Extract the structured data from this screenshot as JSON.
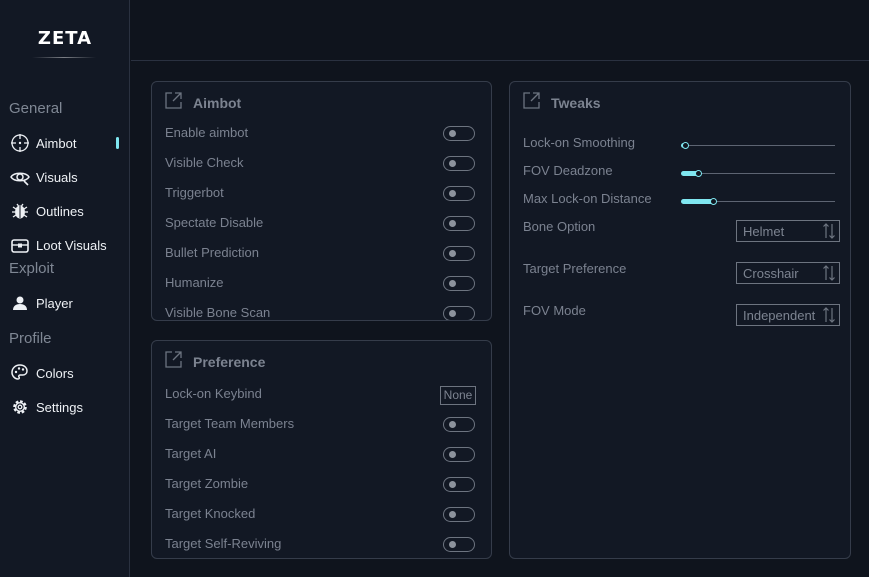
{
  "app": {
    "logo": "ZETA"
  },
  "sidebar": {
    "sections": [
      {
        "label": "General"
      },
      {
        "label": "Exploit"
      },
      {
        "label": "Profile"
      }
    ],
    "items": [
      {
        "label": "Aimbot",
        "icon": "crosshair-icon",
        "active": true
      },
      {
        "label": "Visuals",
        "icon": "eye-icon"
      },
      {
        "label": "Outlines",
        "icon": "bug-icon"
      },
      {
        "label": "Loot Visuals",
        "icon": "chest-icon"
      },
      {
        "label": "Player",
        "icon": "user-icon"
      },
      {
        "label": "Colors",
        "icon": "palette-icon"
      },
      {
        "label": "Settings",
        "icon": "gear-icon"
      }
    ],
    "accent_color": "#7fe6f0"
  },
  "panels": {
    "aimbot": {
      "title": "Aimbot",
      "rows": [
        {
          "label": "Enable aimbot",
          "on": false
        },
        {
          "label": "Visible Check",
          "on": false
        },
        {
          "label": "Triggerbot",
          "on": false
        },
        {
          "label": "Spectate Disable",
          "on": false
        },
        {
          "label": "Bullet Prediction",
          "on": false
        },
        {
          "label": "Humanize",
          "on": false
        },
        {
          "label": "Visible Bone Scan",
          "on": false
        }
      ]
    },
    "preference": {
      "title": "Preference",
      "keybind": {
        "label": "Lock-on Keybind",
        "value": "None"
      },
      "rows": [
        {
          "label": "Target Team Members",
          "on": false
        },
        {
          "label": "Target AI",
          "on": false
        },
        {
          "label": "Target Zombie",
          "on": false
        },
        {
          "label": "Target Knocked",
          "on": false
        },
        {
          "label": "Target Self-Reviving",
          "on": false
        }
      ]
    },
    "tweaks": {
      "title": "Tweaks",
      "sliders": [
        {
          "label": "Lock-on Smoothing",
          "fraction": 0.03
        },
        {
          "label": "FOV Deadzone",
          "fraction": 0.13
        },
        {
          "label": "Max Lock-on Distance",
          "fraction": 0.23
        }
      ],
      "selects": [
        {
          "label": "Bone Option",
          "value": "Helmet"
        },
        {
          "label": "Target Preference",
          "value": "Crosshair"
        },
        {
          "label": "FOV Mode",
          "value": "Independent"
        }
      ]
    }
  }
}
